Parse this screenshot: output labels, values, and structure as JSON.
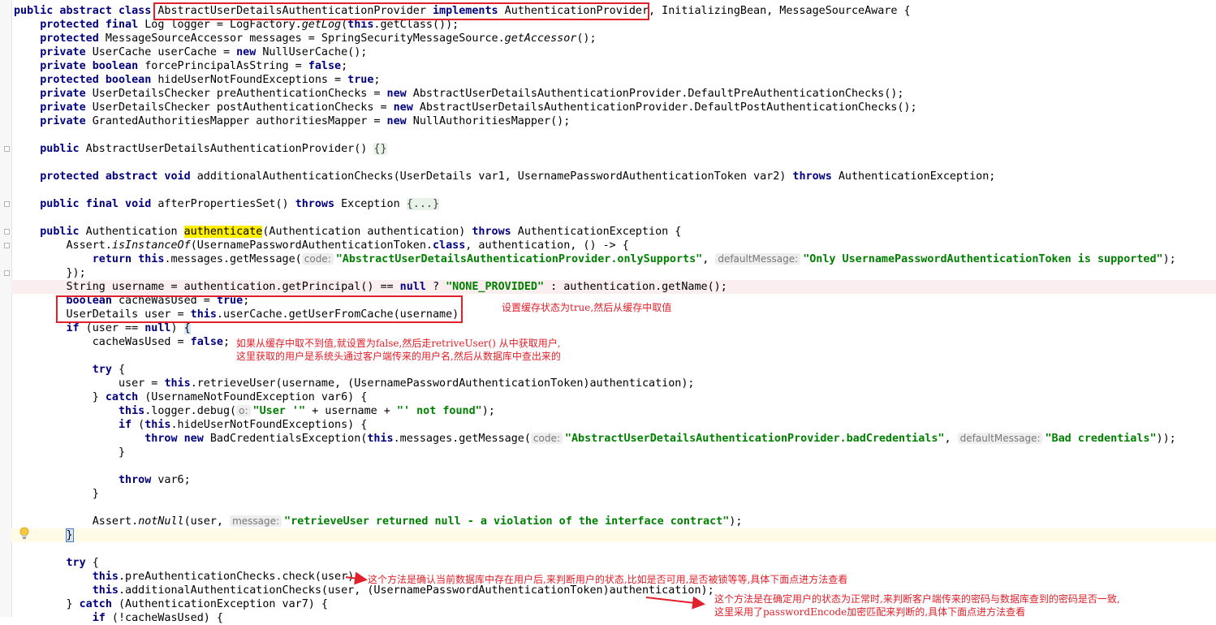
{
  "code": {
    "l1": [
      "public abstract class ",
      "AbstractUserDetailsAuthenticationProvider ",
      "implements",
      " AuthenticationProvider",
      ", InitializingBean, MessageSourceAware {"
    ],
    "l2": [
      "    ",
      "protected final",
      " Log logger = LogFactory.",
      "getLog",
      "(",
      "this",
      ".getClass());"
    ],
    "l3": [
      "    ",
      "protected",
      " MessageSourceAccessor messages = SpringSecurityMessageSource.",
      "getAccessor",
      "();"
    ],
    "l4": [
      "    ",
      "private",
      " UserCache userCache = ",
      "new",
      " NullUserCache();"
    ],
    "l5": [
      "    ",
      "private boolean",
      " forcePrincipalAsString = ",
      "false",
      ";"
    ],
    "l6": [
      "    ",
      "protected boolean",
      " hideUserNotFoundExceptions = ",
      "true",
      ";"
    ],
    "l7": [
      "    ",
      "private",
      " UserDetailsChecker preAuthenticationChecks = ",
      "new",
      " AbstractUserDetailsAuthenticationProvider.DefaultPreAuthenticationChecks();"
    ],
    "l8": [
      "    ",
      "private",
      " UserDetailsChecker postAuthenticationChecks = ",
      "new",
      " AbstractUserDetailsAuthenticationProvider.DefaultPostAuthenticationChecks();"
    ],
    "l9": [
      "    ",
      "private",
      " GrantedAuthoritiesMapper authoritiesMapper = ",
      "new",
      " NullAuthoritiesMapper();"
    ],
    "l11": [
      "    ",
      "public",
      " AbstractUserDetailsAuthenticationProvider() ",
      "{}"
    ],
    "l13": [
      "    ",
      "protected abstract void",
      " additionalAuthenticationChecks(UserDetails var1, UsernamePasswordAuthenticationToken var2) ",
      "throws",
      " AuthenticationException;"
    ],
    "l15": [
      "    ",
      "public final void",
      " afterPropertiesSet() ",
      "throws",
      " Exception ",
      "{...}"
    ],
    "l17": [
      "    ",
      "public",
      " Authentication ",
      "authenticate",
      "(Authentication authentication) ",
      "throws",
      " AuthenticationException {"
    ],
    "l18": [
      "        Assert.",
      "isInstanceOf",
      "(UsernamePasswordAuthenticationToken.",
      "class",
      ", authentication, () -> {"
    ],
    "l19": [
      "            ",
      "return this",
      ".messages.getMessage(",
      "code:",
      "\"AbstractUserDetailsAuthenticationProvider.onlySupports\"",
      ", ",
      "defaultMessage:",
      "\"Only UsernamePasswordAuthenticationToken is supported\"",
      ");"
    ],
    "l20": [
      "        });"
    ],
    "l21": [
      "        String username = authentication.getPrincipal() == ",
      "null",
      " ? ",
      "\"NONE_PROVIDED\"",
      " : authentication.getName();"
    ],
    "l22": [
      "        ",
      "boolean",
      " cacheWasUsed = ",
      "true",
      ";"
    ],
    "l23": [
      "        UserDetails user = ",
      "this",
      ".userCache.getUserFromCache(username);"
    ],
    "l24": [
      "        ",
      "if",
      " (user == ",
      "null",
      ") ",
      "{"
    ],
    "l25": [
      "            cacheWasUsed = ",
      "false",
      ";"
    ],
    "l27": [
      "            ",
      "try",
      " {"
    ],
    "l28": [
      "                user = ",
      "this",
      ".retrieveUser(username, (UsernamePasswordAuthenticationToken)authentication);"
    ],
    "l29": [
      "            } ",
      "catch",
      " (UsernameNotFoundException var6) {"
    ],
    "l30": [
      "                ",
      "this",
      ".logger.debug(",
      "o:",
      "\"User '\"",
      " + username + ",
      "\"' not found\"",
      ");"
    ],
    "l31": [
      "                ",
      "if",
      " (",
      "this",
      ".hideUserNotFoundExceptions) {"
    ],
    "l32": [
      "                    ",
      "throw new",
      " BadCredentialsException(",
      "this",
      ".messages.getMessage(",
      "code:",
      "\"AbstractUserDetailsAuthenticationProvider.badCredentials\"",
      ", ",
      "defaultMessage:",
      "\"Bad credentials\"",
      "));"
    ],
    "l33": [
      "                }"
    ],
    "l35": [
      "                ",
      "throw",
      " var6;"
    ],
    "l36": [
      "            }"
    ],
    "l38": [
      "            Assert.",
      "notNull",
      "(user, ",
      "message:",
      "\"retrieveUser returned null - a violation of the interface contract\"",
      ");"
    ],
    "l39": [
      "        ",
      "}"
    ],
    "l41": [
      "        ",
      "try",
      " {"
    ],
    "l42": [
      "            ",
      "this",
      ".preAuthenticationChecks.check(user);"
    ],
    "l43": [
      "            ",
      "this",
      ".additionalAuthenticationChecks(user, (UsernamePasswordAuthenticationToken)authentication);"
    ],
    "l44": [
      "        } ",
      "catch",
      " (AuthenticationException var7) {"
    ],
    "l45": [
      "            ",
      "if",
      " (!cacheWasUsed) {"
    ]
  },
  "annotations": {
    "cache_note": "设置缓存状态为true,然后从缓存中取值",
    "retrieve_note_1": "如果从缓存中取不到值,就设置为false,然后走retriveUser() 从中获取用户,",
    "retrieve_note_2": "这里获取的用户是系统头通过客户端传来的用户名,然后从数据库中查出来的",
    "pre_check_note": "这个方法是确认当前数据库中存在用户后,来判断用户的状态,比如是否可用,是否被锁等等,具体下面点进方法查看",
    "additional_check_note_1": "这个方法是在确定用户的状态为正常时,来判断客户端传来的密码与数据库查到的密码是否一致,",
    "additional_check_note_2": "这里采用了passwordEncode加密匹配来判断的,具体下面点进方法查看"
  },
  "colors": {
    "keyword": "#000080",
    "string": "#008000",
    "annotation": "#e0202a",
    "search_highlight": "#ffee00"
  },
  "icons": {
    "intention_bulb": "lightbulb-icon"
  }
}
